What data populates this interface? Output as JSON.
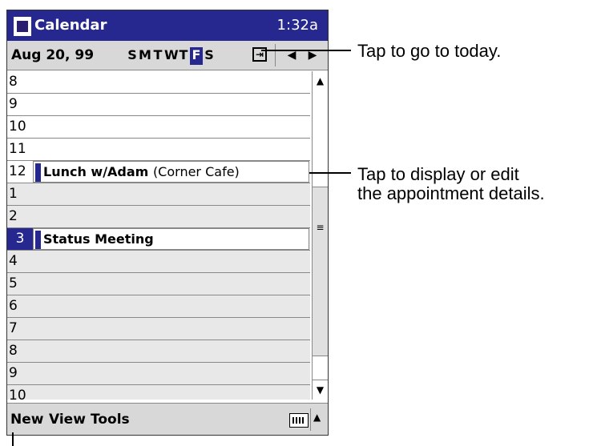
{
  "titlebar": {
    "title": "Calendar",
    "time": "1:32a"
  },
  "navbar": {
    "date": "Aug 20, 99",
    "days": [
      "S",
      "M",
      "T",
      "W",
      "T",
      "F",
      "S"
    ],
    "selected_day_index": 5
  },
  "hours": [
    {
      "label": "8"
    },
    {
      "label": "9"
    },
    {
      "label": "10"
    },
    {
      "label": "11"
    },
    {
      "label": "12"
    },
    {
      "label": "1"
    },
    {
      "label": "2"
    },
    {
      "label": "3"
    },
    {
      "label": "4"
    },
    {
      "label": "5"
    },
    {
      "label": "6"
    },
    {
      "label": "7"
    },
    {
      "label": "8"
    },
    {
      "label": "9"
    },
    {
      "label": "10"
    }
  ],
  "appointments": {
    "lunch": {
      "title": "Lunch w/Adam",
      "location": "(Corner Cafe)"
    },
    "meeting": {
      "title": "Status Meeting"
    }
  },
  "menubar": {
    "new": "New",
    "view": "View",
    "tools": "Tools"
  },
  "callouts": {
    "today": "Tap to go to today.",
    "details_line1": "Tap to display or edit",
    "details_line2": "the appointment details."
  }
}
